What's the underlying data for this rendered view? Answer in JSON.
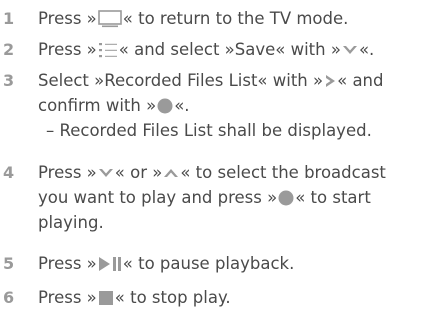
{
  "steps": [
    {
      "num": "1",
      "pre": "Press »",
      "icon": "tv-icon",
      "post": "« to return to the TV mode."
    },
    {
      "num": "2",
      "pre": "Press »",
      "icon": "menu-icon",
      "mid": "« and select »Save« with »",
      "icon2": "chevron-down-icon",
      "post": "«."
    },
    {
      "num": "3",
      "line1_pre": "Select »Recorded Files List« with »",
      "icon": "chevron-right-icon",
      "line1_post": "« and",
      "line2_pre": "confirm with »",
      "icon2": "ok-dot-icon",
      "line2_post": "«.",
      "line3": "– Recorded Files List shall be displayed."
    },
    {
      "num": "4",
      "line1_pre": "Press »",
      "icon": "chevron-down-icon",
      "line1_mid": "« or »",
      "icon2": "chevron-up-icon",
      "line1_post": "« to select the broadcast",
      "line2_pre": "you want to play and press »",
      "icon3": "ok-dot-icon",
      "line2_post": "« to start",
      "line3": "playing."
    },
    {
      "num": "5",
      "pre": "Press »",
      "icon": "play-pause-icon",
      "post": "« to pause playback."
    },
    {
      "num": "6",
      "pre": "Press »",
      "icon": "stop-icon",
      "post": "« to stop play."
    }
  ],
  "colors": {
    "text": "#4a4a4a",
    "number": "#9a9a9a",
    "icon": "#9a9a9a"
  }
}
